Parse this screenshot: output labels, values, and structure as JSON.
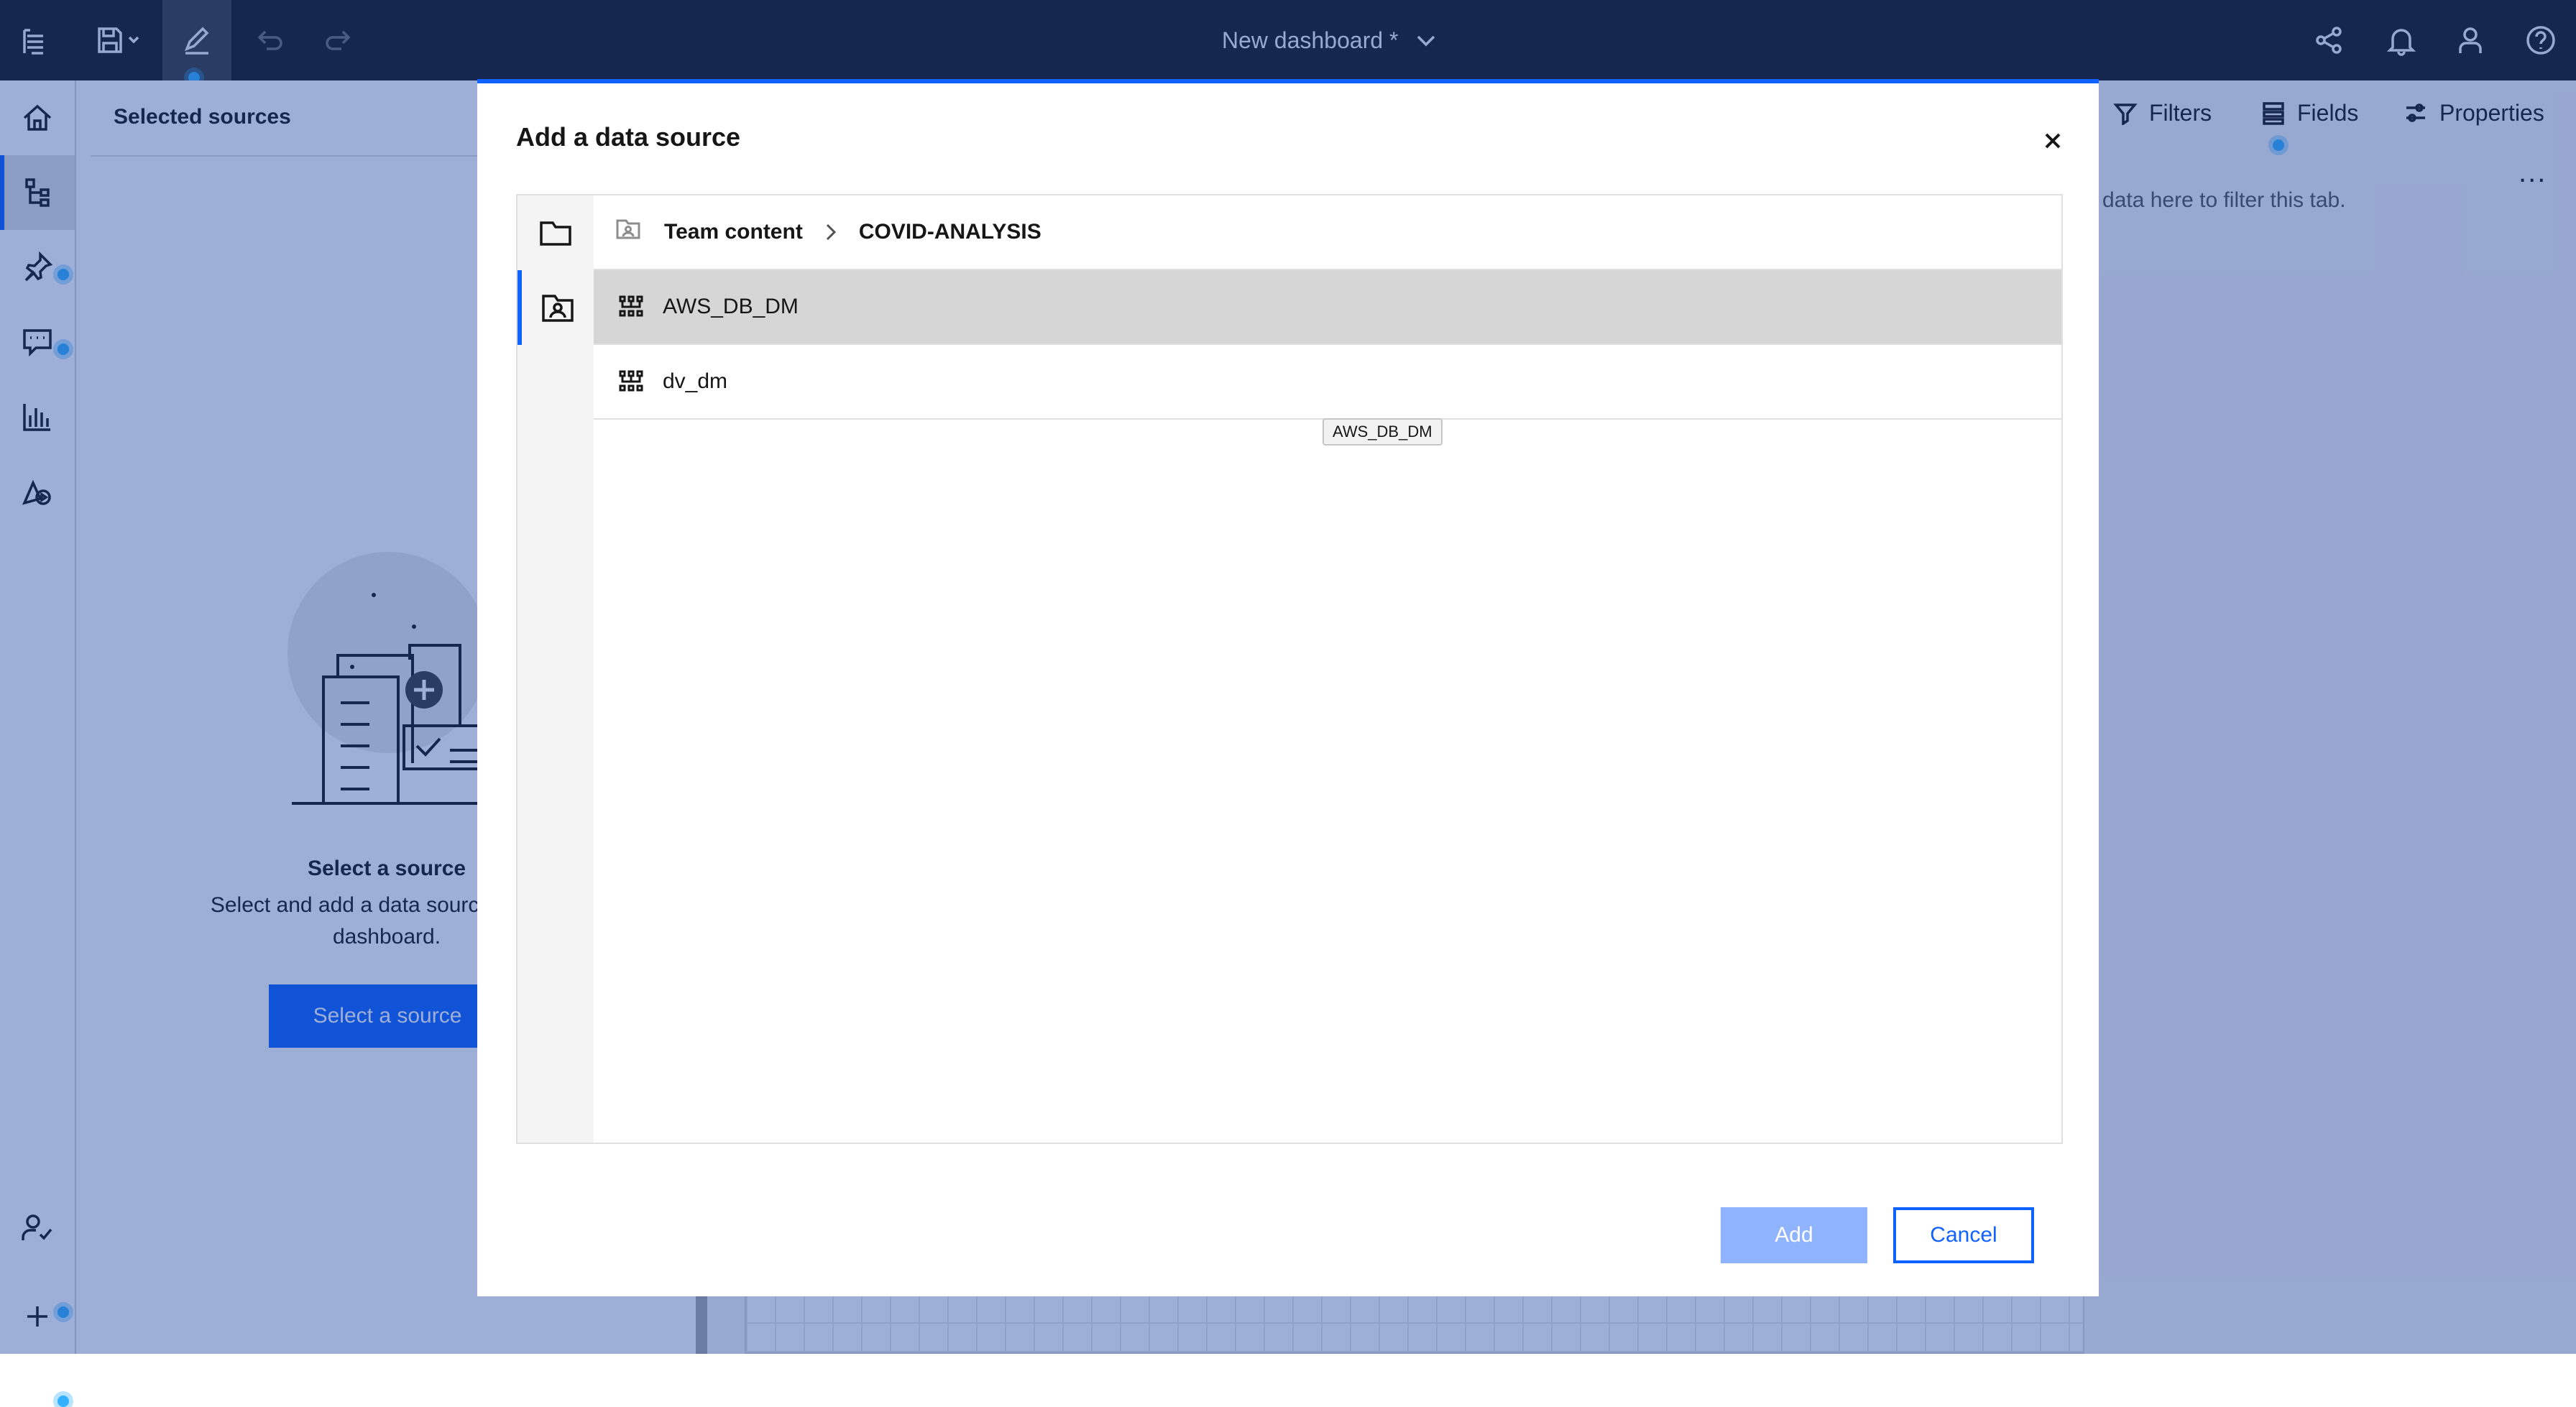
{
  "app": {
    "title": "New dashboard *",
    "toolbar": {
      "menu_icon": "hamburger-menu-icon",
      "save_icon": "save-icon",
      "edit_icon": "edit-pencil-icon",
      "undo_icon": "undo-icon",
      "redo_icon": "redo-icon",
      "share_icon": "share-icon",
      "notifications_icon": "bell-icon",
      "user_icon": "user-icon",
      "help_icon": "help-icon"
    }
  },
  "rail": {
    "items": [
      {
        "name": "home",
        "icon": "home-icon"
      },
      {
        "name": "sources",
        "icon": "data-tree-icon"
      },
      {
        "name": "pins",
        "icon": "pin-icon"
      },
      {
        "name": "comments",
        "icon": "chat-icon"
      },
      {
        "name": "visualizations",
        "icon": "bar-chart-icon"
      },
      {
        "name": "assistant",
        "icon": "shapes-icon"
      }
    ],
    "bottom": [
      {
        "name": "user-access",
        "icon": "user-check-icon"
      },
      {
        "name": "add",
        "icon": "plus-icon"
      }
    ]
  },
  "sources_panel": {
    "title": "Selected sources",
    "empty_title": "Select a source",
    "empty_desc": "Select and add a data source to your dashboard.",
    "select_button": "Select a source"
  },
  "canvas": {
    "filters_label": "Filters",
    "fields_label": "Fields",
    "properties_label": "Properties",
    "filter_hint": "o data here to filter this tab.",
    "more_label": "..."
  },
  "modal": {
    "title": "Add a data source",
    "breadcrumb": {
      "root": "Team content",
      "current": "COVID-ANALYSIS"
    },
    "items": [
      {
        "name": "AWS_DB_DM",
        "selected": true
      },
      {
        "name": "dv_dm",
        "selected": false
      }
    ],
    "tooltip": "AWS_DB_DM",
    "add_button": "Add",
    "cancel_button": "Cancel"
  },
  "colors": {
    "accent": "#0f62fe",
    "topbar": "#161616",
    "overlay": "rgba(22,61,160,0.42)"
  }
}
